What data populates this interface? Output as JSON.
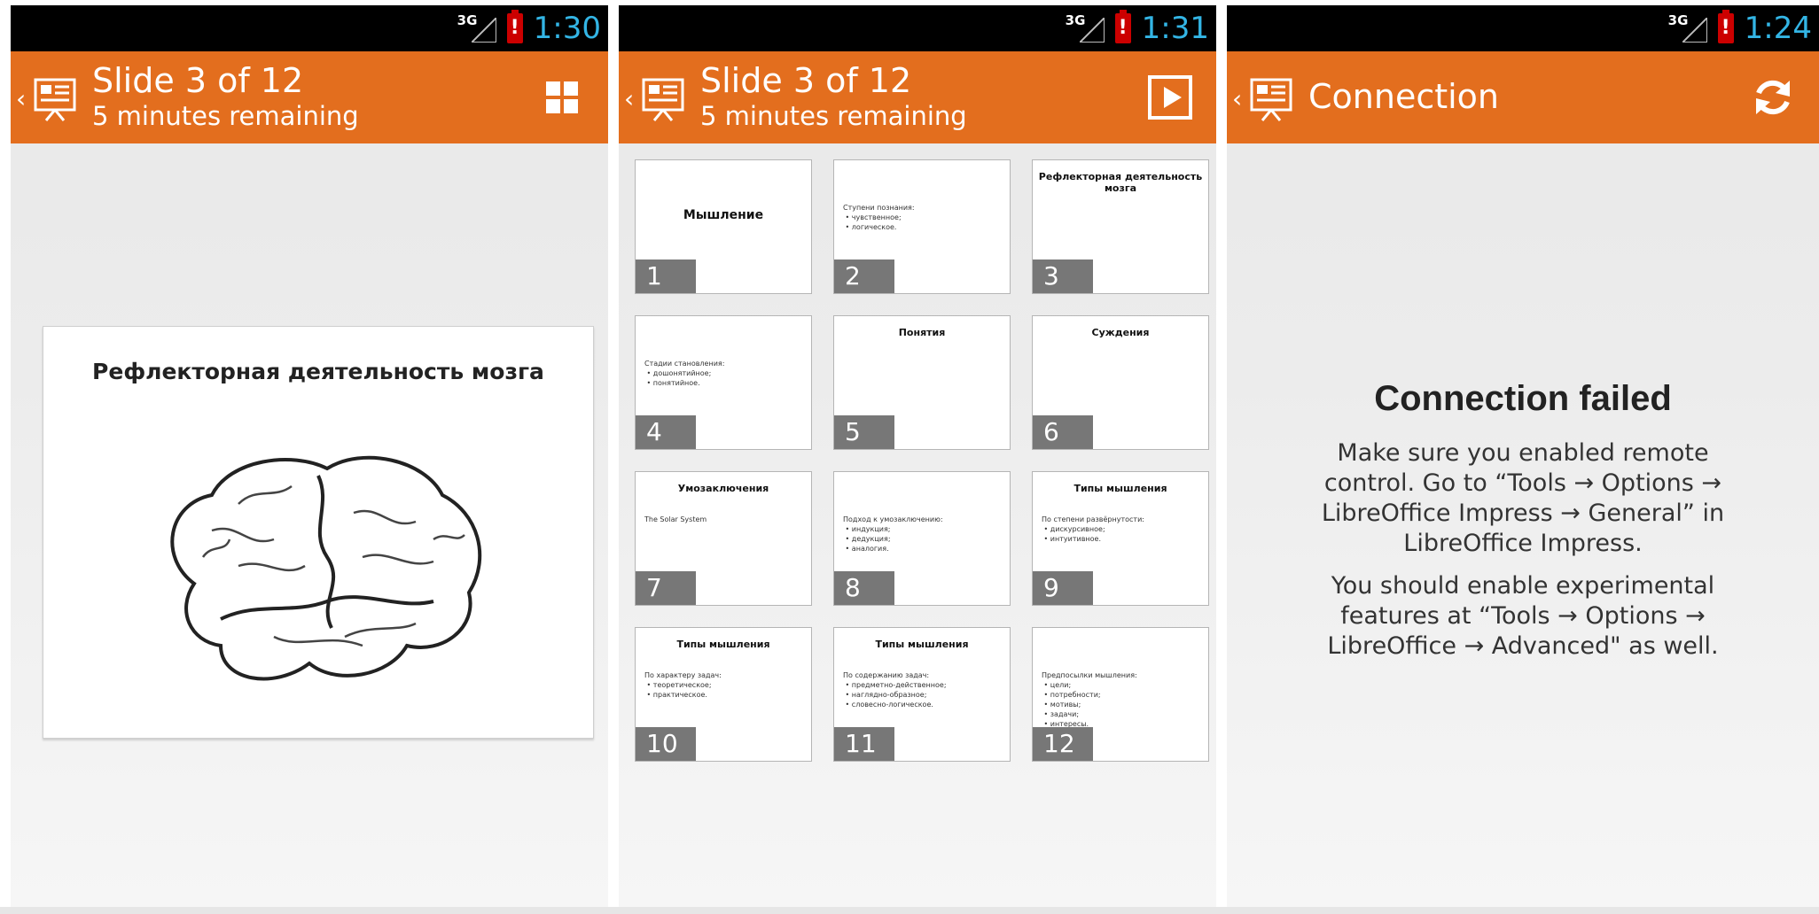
{
  "colors": {
    "action_bar": "#e36e1e",
    "status_bar": "#000000",
    "clock": "#33b5e5",
    "battery": "#cc0000"
  },
  "panels": [
    {
      "status": {
        "network": "3G",
        "time": "1:30"
      },
      "action_bar": {
        "title": "Slide 3 of 12",
        "subtitle": "5 minutes remaining",
        "action_icon": "grid-icon"
      },
      "current_slide": {
        "title": "Рефлекторная деятельность мозга",
        "image": "brain-illustration"
      }
    },
    {
      "status": {
        "network": "3G",
        "time": "1:31"
      },
      "action_bar": {
        "title": "Slide 3 of 12",
        "subtitle": "5 minutes remaining",
        "action_icon": "play-icon"
      },
      "slides": [
        {
          "number": "1",
          "title": "Мышление",
          "text": ""
        },
        {
          "number": "2",
          "title": "",
          "text": "Ступени познания:\n • чувственное;\n • логическое."
        },
        {
          "number": "3",
          "title": "Рефлекторная деятельность мозга",
          "text": ""
        },
        {
          "number": "4",
          "title": "",
          "text": "Стадии становления:\n • дошонятийное;\n • понятийное."
        },
        {
          "number": "5",
          "title": "Понятия",
          "text": ""
        },
        {
          "number": "6",
          "title": "Суждения",
          "text": ""
        },
        {
          "number": "7",
          "title": "Умозаключения",
          "text": "The Solar System"
        },
        {
          "number": "8",
          "title": "",
          "text": "Подход к умозаключению:\n • индукция;\n • дедукция;\n • аналогия."
        },
        {
          "number": "9",
          "title": "Типы мышления",
          "text": "По степени развёрнутости:\n • дискурсивное;\n • интуитивное."
        },
        {
          "number": "10",
          "title": "Типы мышления",
          "text": "По характеру задач:\n • теоретическое;\n • практическое."
        },
        {
          "number": "11",
          "title": "Типы мышления",
          "text": "По содержанию задач:\n • предметно-действенное;\n • наглядно-образное;\n • словесно-логическое."
        },
        {
          "number": "12",
          "title": "",
          "text": "Предпосылки мышления:\n • цели;\n • потребности;\n • мотивы;\n • задачи;\n • интересы."
        }
      ]
    },
    {
      "status": {
        "network": "3G",
        "time": "1:24"
      },
      "action_bar": {
        "title": "Connection",
        "action_icon": "refresh-icon"
      },
      "error": {
        "title": "Connection failed",
        "message1": "Make sure you enabled remote control. Go to “Tools → Options → LibreOffice Impress → General” in LibreOffice Impress.",
        "message2": "You should enable experimental features at “Tools → Options → LibreOffice → Advanced\" as well."
      }
    }
  ]
}
